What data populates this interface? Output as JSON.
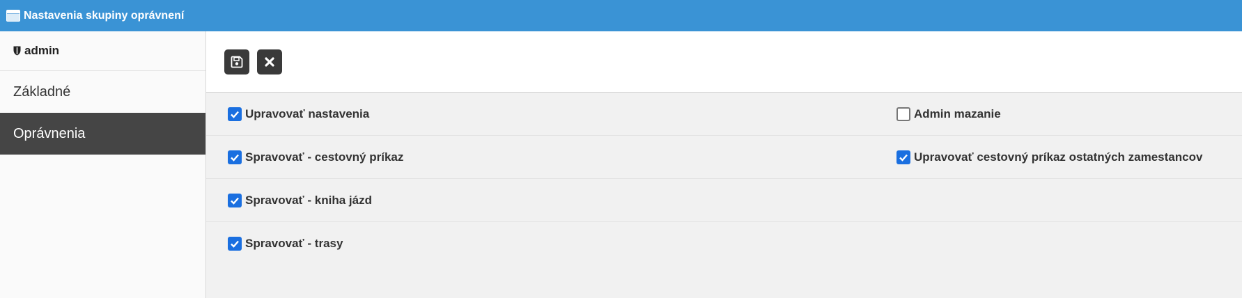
{
  "window": {
    "title": "Nastavenia skupiny oprávnení",
    "icon": "window-icon",
    "accent": "#3a93d5"
  },
  "sidebar": {
    "header": {
      "icon": "shield-icon",
      "label": "admin"
    },
    "items": [
      {
        "label": "Základné",
        "active": false
      },
      {
        "label": "Oprávnenia",
        "active": true
      }
    ]
  },
  "toolbar": {
    "buttons": [
      {
        "name": "save",
        "icon": "floppy-disk-icon"
      },
      {
        "name": "close",
        "icon": "close-icon"
      }
    ]
  },
  "permissions": {
    "rows": [
      {
        "left": {
          "label": "Upravovať nastavenia",
          "checked": true
        },
        "right": {
          "label": "Admin mazanie",
          "checked": false
        }
      },
      {
        "left": {
          "label": "Spravovať - cestovný príkaz",
          "checked": true
        },
        "right": {
          "label": "Upravovať cestovný príkaz ostatných zamestancov",
          "checked": true
        }
      },
      {
        "left": {
          "label": "Spravovať - kniha jázd",
          "checked": true
        }
      },
      {
        "left": {
          "label": "Spravovať - trasy",
          "checked": true
        }
      }
    ]
  }
}
